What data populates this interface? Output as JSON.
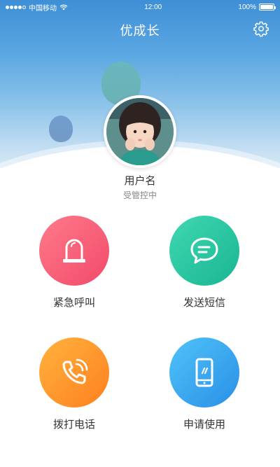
{
  "status_bar": {
    "carrier": "中国移动",
    "time": "12:00",
    "battery": "100%"
  },
  "header": {
    "title": "优成长"
  },
  "profile": {
    "name": "用户名",
    "status": "受管控中"
  },
  "actions": [
    {
      "label": "紧急呼叫",
      "icon": "alarm-light-icon",
      "color": "#f24a6a"
    },
    {
      "label": "发送短信",
      "icon": "message-bubble-icon",
      "color": "#19b592"
    },
    {
      "label": "拨打电话",
      "icon": "phone-icon",
      "color": "#ff7f1f"
    },
    {
      "label": "申请使用",
      "icon": "mobile-device-icon",
      "color": "#2a8fe8"
    }
  ]
}
